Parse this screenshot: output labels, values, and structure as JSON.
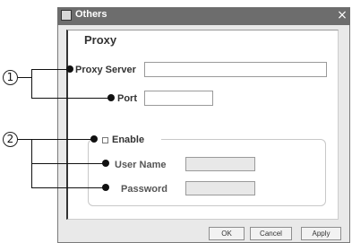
{
  "window": {
    "title": "Others",
    "close_symbol": "×"
  },
  "panel": {
    "heading": "Proxy"
  },
  "proxy": {
    "server_label": "Proxy Server",
    "server_value": "",
    "port_label": "Port",
    "port_value": ""
  },
  "auth": {
    "enable_label": "Enable",
    "enable_checked": false,
    "user_name_label": "User Name",
    "user_name_value": "",
    "password_label": "Password",
    "password_value": ""
  },
  "buttons": {
    "ok": "OK",
    "cancel": "Cancel",
    "apply": "Apply"
  },
  "callouts": {
    "one": "1",
    "two": "2"
  }
}
